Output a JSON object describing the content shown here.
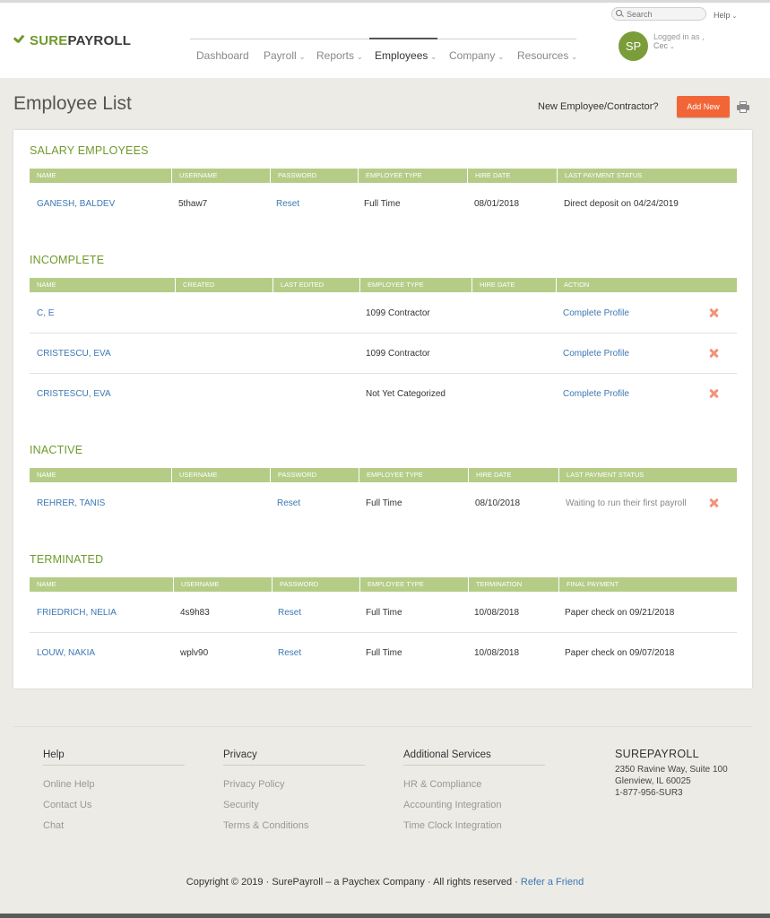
{
  "header": {
    "brand_sure": "SURE",
    "brand_payroll": "PAYROLL",
    "search_placeholder": "Search",
    "help_label": "Help",
    "nav": [
      {
        "label": "Dashboard",
        "has_menu": false
      },
      {
        "label": "Payroll",
        "has_menu": true
      },
      {
        "label": "Reports",
        "has_menu": true
      },
      {
        "label": "Employees",
        "has_menu": true,
        "active": true
      },
      {
        "label": "Company",
        "has_menu": true
      },
      {
        "label": "Resources",
        "has_menu": true
      }
    ],
    "avatar_initials": "SP",
    "logged_in_label": "Logged in as ,",
    "user_name": "Cec"
  },
  "page": {
    "title": "Employee List",
    "new_prompt": "New Employee/Contractor?",
    "add_new_label": "Add New"
  },
  "sections": {
    "salary": {
      "title": "SALARY EMPLOYEES",
      "headers": [
        "NAME",
        "USERNAME",
        "PASSWORD",
        "EMPLOYEE TYPE",
        "HIRE DATE",
        "LAST PAYMENT STATUS"
      ],
      "rows": [
        {
          "name": "GANESH, BALDEV",
          "username": "5thaw7",
          "password": "Reset",
          "type": "Full Time",
          "date": "08/01/2018",
          "status": "Direct deposit on 04/24/2019"
        }
      ]
    },
    "incomplete": {
      "title": "INCOMPLETE",
      "headers": [
        "NAME",
        "CREATED",
        "LAST EDITED",
        "EMPLOYEE TYPE",
        "HIRE DATE",
        "ACTION"
      ],
      "rows": [
        {
          "name": "C, E",
          "created": "",
          "edited": "",
          "type": "1099 Contractor",
          "date": "",
          "action": "Complete Profile"
        },
        {
          "name": "CRISTESCU, EVA",
          "created": "",
          "edited": "",
          "type": "1099 Contractor",
          "date": "",
          "action": "Complete Profile"
        },
        {
          "name": "CRISTESCU, EVA",
          "created": "",
          "edited": "",
          "type": "Not Yet Categorized",
          "date": "",
          "action": "Complete Profile"
        }
      ]
    },
    "inactive": {
      "title": "INACTIVE",
      "headers": [
        "NAME",
        "USERNAME",
        "PASSWORD",
        "EMPLOYEE TYPE",
        "HIRE DATE",
        "LAST PAYMENT STATUS"
      ],
      "rows": [
        {
          "name": "REHRER, TANIS",
          "username": "",
          "password": "Reset",
          "type": "Full Time",
          "date": "08/10/2018",
          "status": "Waiting to run their first payroll"
        }
      ]
    },
    "terminated": {
      "title": "TERMINATED",
      "headers": [
        "NAME",
        "USERNAME",
        "PASSWORD",
        "EMPLOYEE TYPE",
        "TERMINATION",
        "FINAL PAYMENT"
      ],
      "rows": [
        {
          "name": "FRIEDRICH, NELIA",
          "username": "4s9h83",
          "password": "Reset",
          "type": "Full Time",
          "date": "10/08/2018",
          "status": "Paper check on 09/21/2018"
        },
        {
          "name": "LOUW, NAKIA",
          "username": "wplv90",
          "password": "Reset",
          "type": "Full Time",
          "date": "10/08/2018",
          "status": "Paper check on 09/07/2018"
        }
      ]
    }
  },
  "footer": {
    "columns": [
      {
        "title": "Help",
        "links": [
          "Online Help",
          "Contact Us",
          "Chat"
        ]
      },
      {
        "title": "Privacy",
        "links": [
          "Privacy Policy",
          "Security",
          "Terms & Conditions"
        ]
      },
      {
        "title": "Additional Services",
        "links": [
          "HR & Compliance",
          "Accounting Integration",
          "Time Clock Integration"
        ]
      }
    ],
    "company": {
      "name": "SUREPAYROLL",
      "address1": "2350 Ravine Way, Suite 100",
      "address2": "Glenview, IL 60025",
      "phone": "1-877-956-SUR3"
    },
    "copyright": "Copyright © 2019 · SurePayroll – a Paychex Company · All rights reserved ·",
    "refer_link": "Refer a Friend"
  },
  "colors": {
    "brand_green": "#6f9a2c",
    "table_header": "#b5cc87",
    "link_blue": "#3c78b4",
    "add_button": "#f26537",
    "delete_icon": "#f0947a"
  },
  "icons": [
    "logo-check-icon",
    "search-icon",
    "chevron-down-icon",
    "print-icon",
    "delete-x-icon"
  ]
}
